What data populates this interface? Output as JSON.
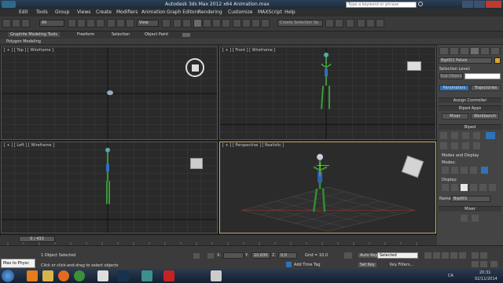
{
  "titlebar": {
    "title": "Autodesk 3ds Max  2012 x64      Animation.max",
    "search_placeholder": "Type a keyword or phrase"
  },
  "menu": [
    "Edit",
    "Tools",
    "Group",
    "Views",
    "Create",
    "Modifiers",
    "Animation",
    "Graph Editors",
    "Rendering",
    "Customize",
    "MAXScript",
    "Help"
  ],
  "toolbar": {
    "selection_filter": "All",
    "view_dropdown": "View",
    "named_selection": "Create Selection Se"
  },
  "ribbon": {
    "tabs": [
      "Graphite Modeling Tools",
      "Freeform",
      "Selection",
      "Object Paint"
    ],
    "sub": "Polygon Modeling"
  },
  "viewports": {
    "top": "[ + ] [ Top ] [ Wireframe ]",
    "front": "[ + ] [ Front ] [ Wireframe ]",
    "left": "[ + ] [ Left ] [ Wireframe ]",
    "perspective": "[ + ] [ Perspective ] [ Realistic ]"
  },
  "cmdpanel": {
    "object_name": "Bip001 Pelvis",
    "selection_level": "Selection Level:",
    "sub_object": "Sub-Object",
    "tabs": [
      "Parameters",
      "Trajectories"
    ],
    "assign_controller": "Assign Controller",
    "biped_apps": "Biped Apps",
    "mixer": "Mixer",
    "workbench": "Workbench",
    "biped": "Biped",
    "modes_display": "Modes and Display",
    "modes": "Modes:",
    "display": "Display:",
    "name_label": "Name:",
    "name_value": "Bip001",
    "mixer_section": "Mixer"
  },
  "timeline": {
    "frame": "0 / 433"
  },
  "status": {
    "maxscript": "Max to Physc",
    "selected": "1 Object Selected",
    "hint": "Click or click-and-drag to select objects",
    "x_label": "X:",
    "y_label": "Y:",
    "z_label": "Z:",
    "y_value": "10,630",
    "z_value": "0,0",
    "grid": "Grid = 10,0",
    "add_time_tag": "Add Time Tag",
    "auto_key": "Auto Key",
    "set_key": "Set Key",
    "selected_dropdown": "Selected",
    "key_filters": "Key Filters..."
  },
  "taskbar": {
    "lang": "CA",
    "time": "20:31",
    "date": "02/11/2014"
  }
}
